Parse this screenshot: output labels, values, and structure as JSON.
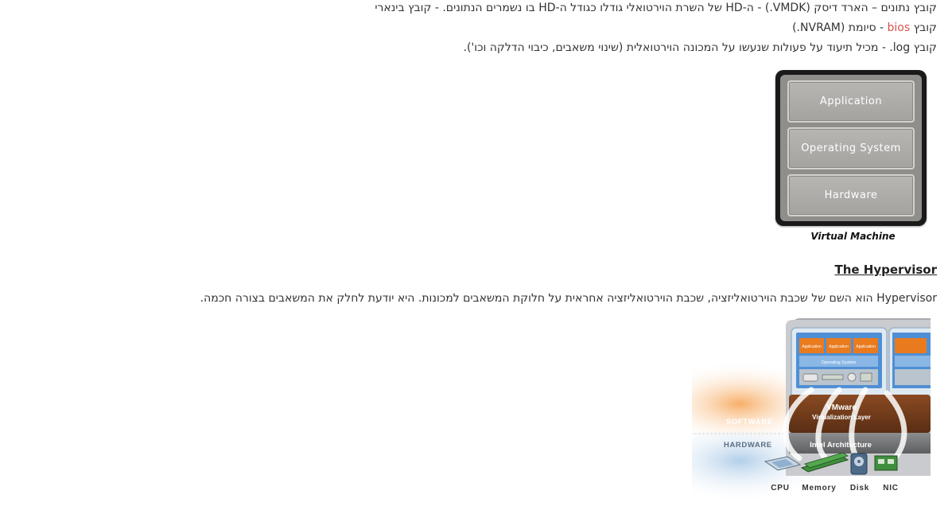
{
  "paragraphs": {
    "line1": "קובץ נתונים – הארד דיסק (VMDK.) - ה-HD של השרת הוירטואלי גודלו כגודל ה-HD בו נשמרים הנתונים. - קובץ בינארי",
    "line2_prefix": "קובץ ",
    "line2_link": "bios",
    "line2_suffix": " - סיומת (NVRAM.)",
    "line3": "קובץ log. - מכיל תיעוד על פעולות שנעשו על המכונה הוירטואלית (שינוי משאבים, כיבוי הדלקה וכו').",
    "hypervisor_heading": "The Hypervisor",
    "line4": "Hypervisor הוא השם של שכבת הוירטואליזציה, שכבת הוירטואליזציה אחראית על חלוקת המשאבים למכונות. היא יודעת לחלק את המשאבים בצורה חכמה."
  },
  "vm_diagram": {
    "layers": [
      "Application",
      "Operating System",
      "Hardware"
    ],
    "caption": "Virtual Machine"
  },
  "vmware_diagram": {
    "app_labels": [
      "Application",
      "Application",
      "Application"
    ],
    "os_label": "Operating System",
    "vmware_title": "VMware",
    "vmware_subtitle": "Virtualization Layer",
    "software_label": "SOFTWARE",
    "hardware_label": "HARDWARE",
    "intel_label": "Intel Architecture",
    "hw_labels": [
      "CPU",
      "Memory",
      "Disk",
      "NIC"
    ]
  },
  "colors": {
    "link": "#d9534f",
    "orange": "#e87722",
    "brown": "#6b3a1c"
  }
}
